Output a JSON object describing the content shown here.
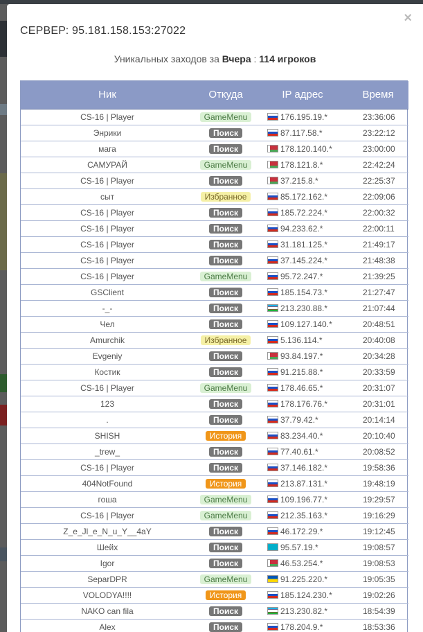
{
  "modal": {
    "close_glyph": "×",
    "server_title": "СЕРВЕР: 95.181.158.153:27022",
    "uniq_prefix": "Уникальных заходов за",
    "uniq_period": "Вчера",
    "uniq_sep": ":",
    "uniq_count": "114 игроков"
  },
  "table": {
    "headers": [
      "Ник",
      "Откуда",
      "IP адрес",
      "Время"
    ],
    "colors": {
      "header_bg": "#8b9ac6",
      "search": "#777777",
      "gamemenu": "#d9f0d3",
      "favorites": "#f5f0a6",
      "history": "#f0961a"
    },
    "rows": [
      {
        "nick": "CS-16 | Player",
        "source": "GameMenu",
        "type": "gm",
        "flag": "ru",
        "ip": "176.195.19.*",
        "time": "23:36:06"
      },
      {
        "nick": "Энрики",
        "source": "Поиск",
        "type": "search",
        "flag": "ru",
        "ip": "87.117.58.*",
        "time": "23:22:12"
      },
      {
        "nick": "мага",
        "source": "Поиск",
        "type": "search",
        "flag": "by",
        "ip": "178.120.140.*",
        "time": "23:00:00"
      },
      {
        "nick": "САМУРАЙ",
        "source": "GameMenu",
        "type": "gm",
        "flag": "by",
        "ip": "178.121.8.*",
        "time": "22:42:24"
      },
      {
        "nick": "CS-16 | Player",
        "source": "Поиск",
        "type": "search",
        "flag": "by",
        "ip": "37.215.8.*",
        "time": "22:25:37"
      },
      {
        "nick": "сыт",
        "source": "Избранное",
        "type": "fav",
        "flag": "ru",
        "ip": "85.172.162.*",
        "time": "22:09:06"
      },
      {
        "nick": "CS-16 | Player",
        "source": "Поиск",
        "type": "search",
        "flag": "ru",
        "ip": "185.72.224.*",
        "time": "22:00:32"
      },
      {
        "nick": "CS-16 | Player",
        "source": "Поиск",
        "type": "search",
        "flag": "ru",
        "ip": "94.233.62.*",
        "time": "22:00:11"
      },
      {
        "nick": "CS-16 | Player",
        "source": "Поиск",
        "type": "search",
        "flag": "ru",
        "ip": "31.181.125.*",
        "time": "21:49:17"
      },
      {
        "nick": "CS-16 | Player",
        "source": "Поиск",
        "type": "search",
        "flag": "ru",
        "ip": "37.145.224.*",
        "time": "21:48:38"
      },
      {
        "nick": "CS-16 | Player",
        "source": "GameMenu",
        "type": "gm",
        "flag": "ru",
        "ip": "95.72.247.*",
        "time": "21:39:25"
      },
      {
        "nick": "GSClient",
        "source": "Поиск",
        "type": "search",
        "flag": "ru",
        "ip": "185.154.73.*",
        "time": "21:27:47"
      },
      {
        "nick": "-_-",
        "source": "Поиск",
        "type": "search",
        "flag": "uz",
        "ip": "213.230.88.*",
        "time": "21:07:44"
      },
      {
        "nick": "Чел",
        "source": "Поиск",
        "type": "search",
        "flag": "ru",
        "ip": "109.127.140.*",
        "time": "20:48:51"
      },
      {
        "nick": "Amurchik",
        "source": "Избранное",
        "type": "fav",
        "flag": "ru",
        "ip": "5.136.114.*",
        "time": "20:40:08"
      },
      {
        "nick": "Evgeniy",
        "source": "Поиск",
        "type": "search",
        "flag": "by",
        "ip": "93.84.197.*",
        "time": "20:34:28"
      },
      {
        "nick": "Костик",
        "source": "Поиск",
        "type": "search",
        "flag": "ru",
        "ip": "91.215.88.*",
        "time": "20:33:59"
      },
      {
        "nick": "CS-16 | Player",
        "source": "GameMenu",
        "type": "gm",
        "flag": "ru",
        "ip": "178.46.65.*",
        "time": "20:31:07"
      },
      {
        "nick": "123",
        "source": "Поиск",
        "type": "search",
        "flag": "ru",
        "ip": "178.176.76.*",
        "time": "20:31:01"
      },
      {
        "nick": ".",
        "source": "Поиск",
        "type": "search",
        "flag": "ru",
        "ip": "37.79.42.*",
        "time": "20:14:14"
      },
      {
        "nick": "SHISH",
        "source": "История",
        "type": "hist",
        "flag": "ru",
        "ip": "83.234.40.*",
        "time": "20:10:40"
      },
      {
        "nick": "_trew_",
        "source": "Поиск",
        "type": "search",
        "flag": "ru",
        "ip": "77.40.61.*",
        "time": "20:08:52"
      },
      {
        "nick": "CS-16 | Player",
        "source": "Поиск",
        "type": "search",
        "flag": "ru",
        "ip": "37.146.182.*",
        "time": "19:58:36"
      },
      {
        "nick": "404NotFound",
        "source": "История",
        "type": "hist",
        "flag": "ru",
        "ip": "213.87.131.*",
        "time": "19:48:19"
      },
      {
        "nick": "гоша",
        "source": "GameMenu",
        "type": "gm",
        "flag": "ru",
        "ip": "109.196.77.*",
        "time": "19:29:57"
      },
      {
        "nick": "CS-16 | Player",
        "source": "GameMenu",
        "type": "gm",
        "flag": "ru",
        "ip": "212.35.163.*",
        "time": "19:16:29"
      },
      {
        "nick": "Z_e_Jl_e_N_u_Y__4aY",
        "source": "Поиск",
        "type": "search",
        "flag": "ru",
        "ip": "46.172.29.*",
        "time": "19:12:45"
      },
      {
        "nick": "Шейх",
        "source": "Поиск",
        "type": "search",
        "flag": "kz",
        "ip": "95.57.19.*",
        "time": "19:08:57"
      },
      {
        "nick": "Igor",
        "source": "Поиск",
        "type": "search",
        "flag": "by",
        "ip": "46.53.254.*",
        "time": "19:08:53"
      },
      {
        "nick": "SeparDPR",
        "source": "GameMenu",
        "type": "gm",
        "flag": "ua",
        "ip": "91.225.220.*",
        "time": "19:05:35"
      },
      {
        "nick": "VOLODYA!!!!",
        "source": "История",
        "type": "hist",
        "flag": "ru",
        "ip": "185.124.230.*",
        "time": "19:02:26"
      },
      {
        "nick": "NAKO can fila",
        "source": "Поиск",
        "type": "search",
        "flag": "uz",
        "ip": "213.230.82.*",
        "time": "18:54:39"
      },
      {
        "nick": "Alex",
        "source": "Поиск",
        "type": "search",
        "flag": "ru",
        "ip": "178.204.9.*",
        "time": "18:53:36"
      }
    ]
  }
}
